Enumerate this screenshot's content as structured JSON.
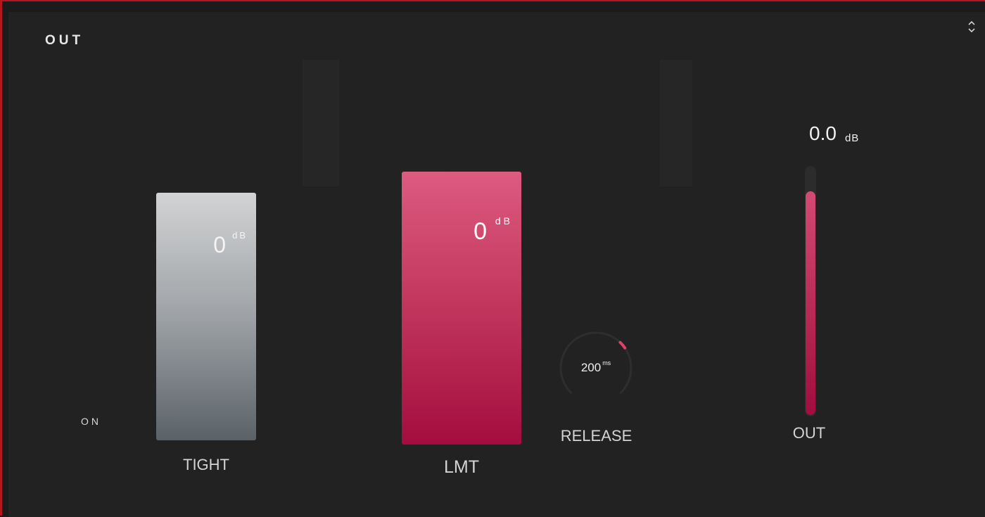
{
  "section": {
    "title": "OUT",
    "collapse_icon": "collapse-chevrons-icon"
  },
  "power": {
    "label": "ON"
  },
  "tight": {
    "value": "0",
    "unit": "dB",
    "label": "TIGHT",
    "color_top": "#d2d3d4",
    "color_bottom": "#5a6268"
  },
  "lmt": {
    "value": "0",
    "unit": "dB",
    "label": "LMT",
    "color_top": "#dd5a80",
    "color_bottom": "#a40d3f"
  },
  "release": {
    "value": "200",
    "unit": "ms",
    "label": "RELEASE",
    "knob_fraction": 0.05,
    "accent": "#e0406a"
  },
  "out": {
    "value": "0.0",
    "unit": "dB",
    "label": "OUT",
    "meter_fraction": 0.9,
    "accent": "#c42b58"
  }
}
